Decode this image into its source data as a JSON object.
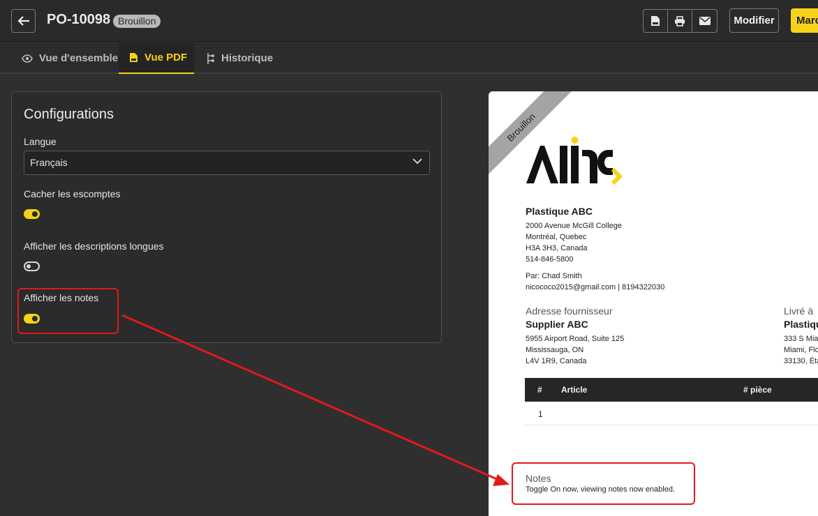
{
  "header": {
    "back_icon": "arrow-left-icon",
    "title": "PO-10098",
    "status": "Brouillon",
    "icons": [
      "pdf-icon",
      "print-icon",
      "mail-icon"
    ],
    "modify_label": "Modifier",
    "primary_label": "Marc"
  },
  "tabs": [
    {
      "label": "Vue d'ensemble",
      "icon": "eye-icon",
      "active": false
    },
    {
      "label": "Vue PDF",
      "icon": "pdf-icon",
      "active": true
    },
    {
      "label": "Historique",
      "icon": "history-icon",
      "active": false
    }
  ],
  "config": {
    "title": "Configurations",
    "language_label": "Langue",
    "language_value": "Français",
    "hide_discounts_label": "Cacher les escomptes",
    "hide_discounts_on": true,
    "long_desc_label": "Afficher les descriptions longues",
    "long_desc_on": false,
    "notes_label": "Afficher les notes",
    "notes_on": true
  },
  "pdf": {
    "ribbon": "Brouillon",
    "company": {
      "name": "Plastique ABC",
      "addr1": "2000 Avenue McGill College",
      "addr2": "Montréal, Quebec",
      "addr3": "H3A 3H3, Canada",
      "phone": "514-846-5800",
      "by": "Par: Chad Smith",
      "contact": "nicococo2015@gmail.com | 8194322030"
    },
    "supplier": {
      "label": "Adresse fournisseur",
      "name": "Supplier ABC",
      "addr1": "5955 Airport Road, Suite 125",
      "addr2": "Mississauga, ON",
      "addr3": "L4V 1R9, Canada"
    },
    "ship_to": {
      "label": "Livré à",
      "name": "Plastiqu",
      "addr1": "333 S Mia",
      "addr2": "Miami, Flo",
      "addr3": "33130, Éta"
    },
    "table": {
      "headers": [
        "#",
        "Article",
        "# pièce"
      ],
      "rows": [
        [
          "1"
        ]
      ]
    },
    "notes": {
      "title": "Notes",
      "text": "Toggle On now, viewing notes now enabled."
    }
  },
  "colors": {
    "accent": "#f6d31a",
    "annotation": "#e0191b",
    "background": "#2f2f2f"
  }
}
